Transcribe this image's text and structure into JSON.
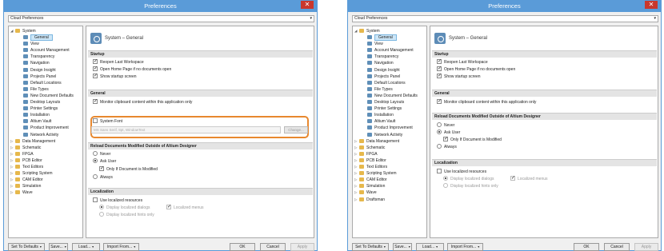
{
  "window_title": "Preferences",
  "close_glyph": "✕",
  "dropdown_value": "Cloud Preferences",
  "dropdown_arrow": "▾",
  "panel_title": "System – General",
  "tree_exp_glyph": {
    "expanded": "◢",
    "collapsed": "▷"
  },
  "sections": {
    "startup": "Startup",
    "general": "General",
    "reload": "Reload Documents Modified Outside of Altium Designer",
    "localization": "Localization"
  },
  "startup_options": [
    "Reopen Last Workspace",
    "Open Home Page if no documents open",
    "Show startup screen"
  ],
  "general_option": "Monitor clipboard content within this application only",
  "system_font": {
    "label": "System Font",
    "value": "MS Sans Serif, 8pt, WindowText",
    "button": "Change..."
  },
  "reload_options": {
    "never": "Never",
    "ask": "Ask User",
    "only_modified": "Only If Document is Modified",
    "always": "Always"
  },
  "localization": {
    "use": "Use localized resources",
    "dialogs": "Display localized dialogs",
    "menus": "Localized menus",
    "hints": "Display localized hints only"
  },
  "buttons": {
    "set_defaults": "Set To Defaults",
    "save": "Save...",
    "load": "Load...",
    "import": "Import From...",
    "ok": "OK",
    "cancel": "Cancel",
    "apply": "Apply",
    "dropdown_glyph": "▾"
  },
  "tree_system": "System",
  "system_children": [
    "General",
    "View",
    "Account Management",
    "Transparency",
    "Navigation",
    "Design Insight",
    "Projects Panel",
    "Default Locations",
    "File Types",
    "New Document Defaults",
    "Desktop Layouts",
    "Printer Settings",
    "Installation",
    "Altium Vault",
    "Product Improvement",
    "Network Activity"
  ],
  "left_other": [
    "Data Management",
    "Schematic",
    "FPGA",
    "PCB Editor",
    "Text Editors",
    "Scripting System",
    "CAM Editor",
    "Simulation",
    "Wave"
  ],
  "right_other": [
    "Data Management",
    "Schematic",
    "FPGA",
    "PCB Editor",
    "Text Editors",
    "Scripting System",
    "CAM Editor",
    "Simulation",
    "Wave",
    "Draftsman"
  ],
  "colors": {
    "titlebar": "#5a9bd8",
    "highlight": "#e8882e",
    "close": "#c9372c",
    "selection": "#cde6f7"
  }
}
